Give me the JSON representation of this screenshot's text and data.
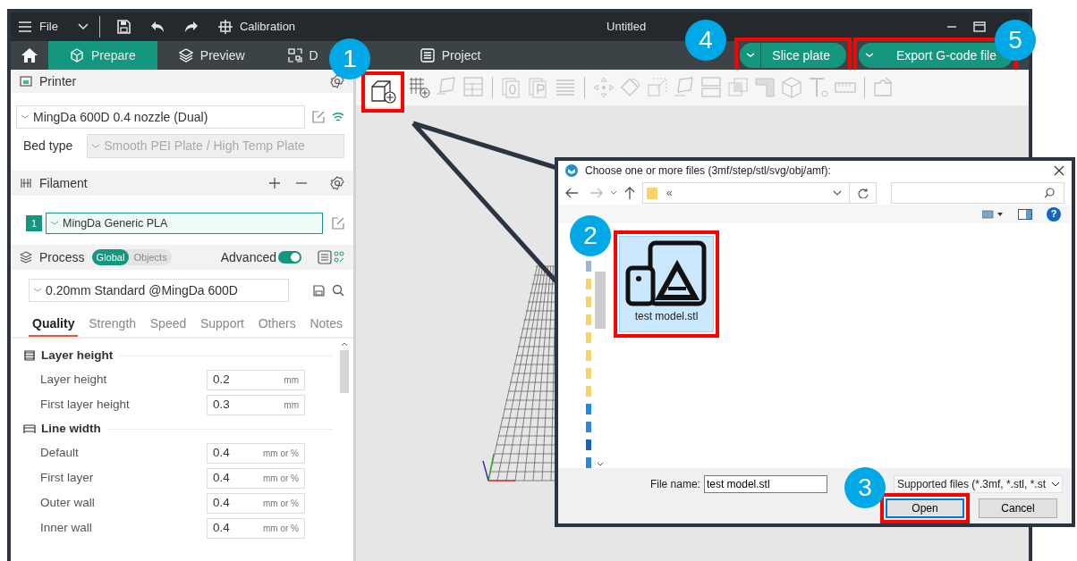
{
  "window": {
    "title": "Untitled"
  },
  "menu_bar": {
    "file": "File",
    "calibration": "Calibration"
  },
  "tabs": [
    {
      "label": "Prepare",
      "selected": true
    },
    {
      "label": "Preview",
      "selected": false
    },
    {
      "label": "D",
      "selected": false
    },
    {
      "label": "Project",
      "selected": false
    }
  ],
  "actions": [
    {
      "label": "Slice plate",
      "highlighted": true
    },
    {
      "label": "Export G-code file",
      "highlighted": true
    }
  ],
  "toolbar": {
    "add_highlighted": true
  },
  "printer": {
    "title": "Printer",
    "preset": "MingDa 600D 0.4 nozzle (Dual)",
    "bed_type_label": "Bed type",
    "bed_type": "Smooth PEI Plate / High Temp Plate"
  },
  "filament": {
    "title": "Filament",
    "items": [
      {
        "index": "1",
        "name": "MingDa Generic PLA"
      }
    ]
  },
  "process": {
    "title": "Process",
    "scopes": [
      {
        "label": "Global",
        "selected": true
      },
      {
        "label": "Objects",
        "selected": false
      }
    ],
    "advanced_label": "Advanced",
    "advanced_on": true,
    "preset": "0.20mm Standard @MingDa 600D",
    "tabs": [
      {
        "label": "Quality",
        "selected": true
      },
      {
        "label": "Strength",
        "selected": false
      },
      {
        "label": "Speed",
        "selected": false
      },
      {
        "label": "Support",
        "selected": false
      },
      {
        "label": "Others",
        "selected": false
      },
      {
        "label": "Notes",
        "selected": false
      }
    ],
    "groups": [
      {
        "title": "Layer height",
        "settings": [
          {
            "label": "Layer height",
            "value": "0.2",
            "unit": "mm"
          },
          {
            "label": "First layer height",
            "value": "0.3",
            "unit": "mm"
          }
        ]
      },
      {
        "title": "Line width",
        "settings": [
          {
            "label": "Default",
            "value": "0.4",
            "unit": "mm or %"
          },
          {
            "label": "First layer",
            "value": "0.4",
            "unit": "mm or %"
          },
          {
            "label": "Outer wall",
            "value": "0.4",
            "unit": "mm or %"
          },
          {
            "label": "Inner wall",
            "value": "0.4",
            "unit": "mm or %"
          }
        ]
      }
    ]
  },
  "dialog": {
    "title": "Choose one or more files (3mf/step/stl/svg/obj/amf):",
    "path": "«",
    "files": [
      {
        "name": "test model.stl",
        "selected": true,
        "highlighted": true
      }
    ],
    "file_name_label": "File name:",
    "file_name": "test model.stl",
    "file_type": "Supported files (*.3mf, *.stl, *.st",
    "help_label": "?",
    "buttons": [
      {
        "label": "Open",
        "kind": "primary",
        "highlighted": true
      },
      {
        "label": "Cancel",
        "kind": "secondary",
        "highlighted": false
      }
    ]
  },
  "callouts": [
    "1",
    "2",
    "3",
    "4",
    "5"
  ]
}
